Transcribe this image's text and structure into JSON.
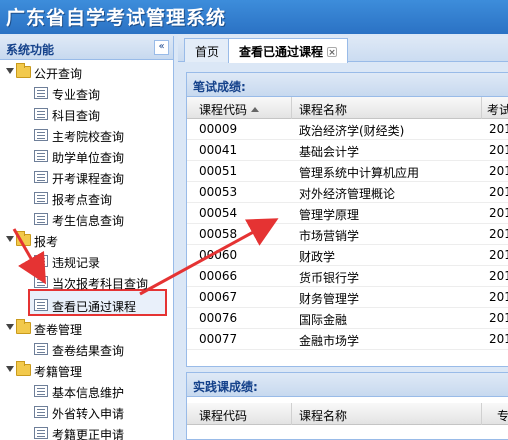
{
  "header": {
    "title": "广东省自学考试管理系统"
  },
  "sidebar": {
    "title": "系统功能",
    "collapse_icon": "«",
    "groups": [
      {
        "label": "公开查询",
        "items": [
          "专业查询",
          "科目查询",
          "主考院校查询",
          "助学单位查询",
          "开考课程查询",
          "报考点查询",
          "考生信息查询"
        ]
      },
      {
        "label": "报考",
        "items": [
          "违规记录",
          "当次报考科目查询",
          "查看已通过课程"
        ]
      },
      {
        "label": "查卷管理",
        "items": [
          "查卷结果查询"
        ]
      },
      {
        "label": "考籍管理",
        "items": [
          "基本信息维护",
          "外省转入申请",
          "考籍更正申请"
        ]
      }
    ]
  },
  "tabs": [
    {
      "label": "首页"
    },
    {
      "label": "查看已通过课程",
      "close_icon": "×"
    }
  ],
  "written_panel": {
    "title": "笔试成绩:",
    "columns": [
      "课程代码",
      "课程名称",
      "考试"
    ],
    "rows": [
      {
        "code": "00009",
        "name": "政治经济学(财经类)",
        "date": "201"
      },
      {
        "code": "00041",
        "name": "基础会计学",
        "date": "201"
      },
      {
        "code": "00051",
        "name": "管理系统中计算机应用",
        "date": "201"
      },
      {
        "code": "00053",
        "name": "对外经济管理概论",
        "date": "201"
      },
      {
        "code": "00054",
        "name": "管理学原理",
        "date": "201"
      },
      {
        "code": "00058",
        "name": "市场营销学",
        "date": "201"
      },
      {
        "code": "00060",
        "name": "财政学",
        "date": "201"
      },
      {
        "code": "00066",
        "name": "货币银行学",
        "date": "201"
      },
      {
        "code": "00067",
        "name": "财务管理学",
        "date": "201"
      },
      {
        "code": "00076",
        "name": "国际金融",
        "date": "201"
      },
      {
        "code": "00077",
        "name": "金融市场学",
        "date": "201"
      }
    ]
  },
  "practice_panel": {
    "title": "实践课成绩:",
    "columns": [
      "课程代码",
      "课程名称",
      "专"
    ]
  },
  "colors": {
    "annotation": "#e53333",
    "header": "#2b72c4",
    "panel_title": "#15428b"
  }
}
